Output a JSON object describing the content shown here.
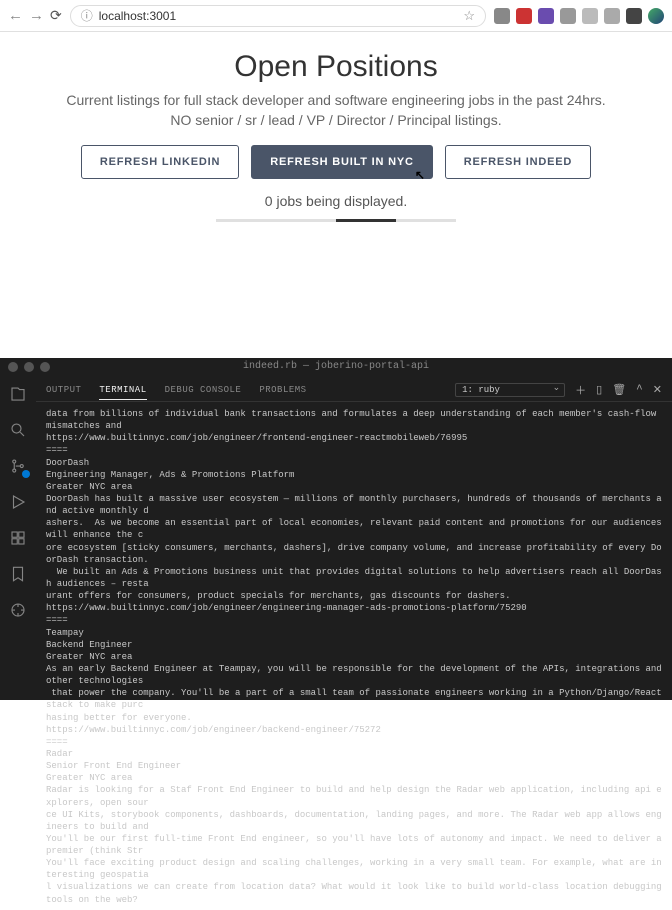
{
  "browser": {
    "url": "localhost:3001"
  },
  "page": {
    "title": "Open Positions",
    "subtitle_line1": "Current listings for full stack developer and software engineering jobs in the past 24hrs.",
    "subtitle_line2": "NO senior / sr / lead / VP / Director / Principal listings.",
    "buttons": {
      "linkedin": "REFRESH LINKEDIN",
      "builtin": "REFRESH BUILT IN NYC",
      "indeed": "REFRESH INDEED"
    },
    "status": "0 jobs being displayed."
  },
  "editor": {
    "window_title": "indeed.rb — joberino-portal-api",
    "tabs": {
      "output": "OUTPUT",
      "terminal": "TERMINAL",
      "debug": "DEBUG CONSOLE",
      "problems": "PROBLEMS"
    },
    "dropdown": "1: ruby",
    "terminal_lines": [
      "data from billions of individual bank transactions and formulates a deep understanding of each member's cash-flow mismatches and",
      "https://www.builtinnyc.com/job/engineer/frontend-engineer-reactmobileweb/76995",
      "====",
      "DoorDash",
      "Engineering Manager, Ads & Promotions Platform",
      "Greater NYC area",
      "DoorDash has built a massive user ecosystem — millions of monthly purchasers, hundreds of thousands of merchants and active monthly d",
      "ashers.  As we become an essential part of local economies, relevant paid content and promotions for our audiences will enhance the c",
      "ore ecosystem [sticky consumers, merchants, dashers], drive company volume, and increase profitability of every DoorDash transaction.",
      "  We built an Ads & Promotions business unit that provides digital solutions to help advertisers reach all DoorDash audiences – resta",
      "urant offers for consumers, product specials for merchants, gas discounts for dashers.",
      "https://www.builtinnyc.com/job/engineer/engineering-manager-ads-promotions-platform/75290",
      "====",
      "Teampay",
      "Backend Engineer",
      "Greater NYC area",
      "As an early Backend Engineer at Teampay, you will be responsible for the development of the APIs, integrations and other technologies",
      " that power the company. You'll be a part of a small team of passionate engineers working in a Python/Django/React stack to make purc",
      "hasing better for everyone.",
      "https://www.builtinnyc.com/job/engineer/backend-engineer/75272",
      "====",
      "Radar",
      "Senior Front End Engineer",
      "Greater NYC area",
      "Radar is looking for a Staf Front End Engineer to build and help design the Radar web application, including api explorers, open sour",
      "ce UI Kits, storybook components, dashboards, documentation, landing pages, and more. The Radar web app allows engineers to build and",
      "You'll be our first full-time Front End engineer, so you'll have lots of autonomy and impact. We need to deliver a premier (think Str",
      "You'll face exciting product design and scaling challenges, working in a very small team. For example, what are interesting geospatia",
      "l visualizations we can create from location data? What would it look like to build world-class location debugging tools on the web?"
    ]
  }
}
